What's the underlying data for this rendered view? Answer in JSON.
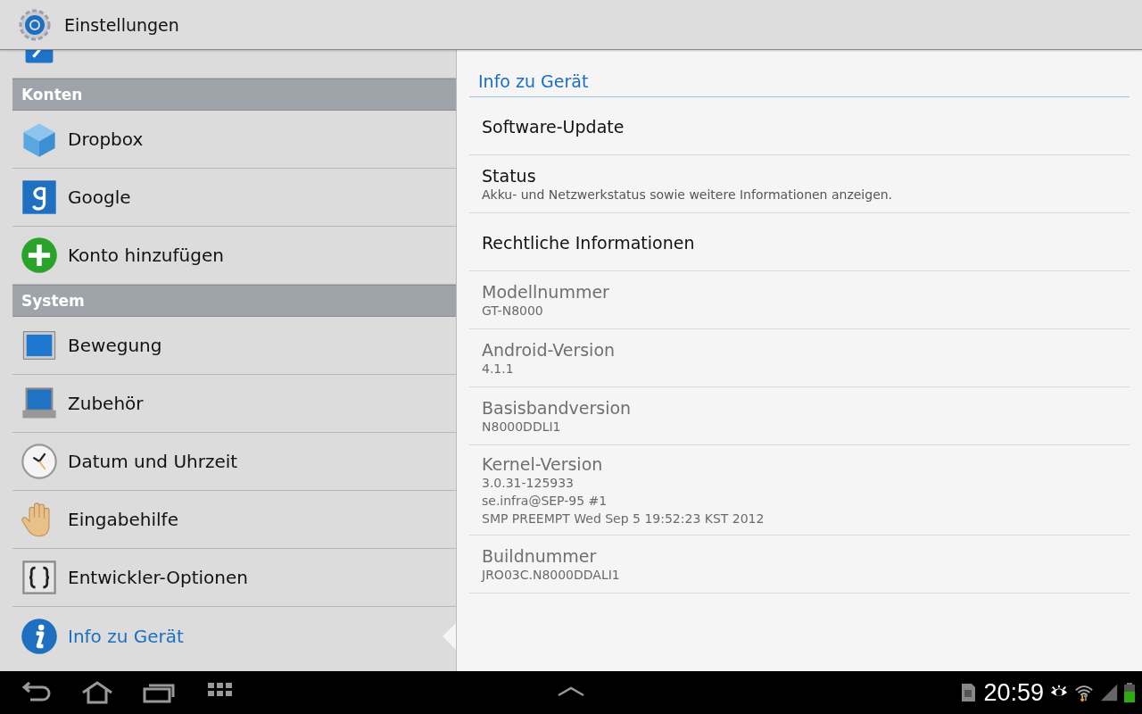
{
  "action_bar": {
    "title": "Einstellungen"
  },
  "sidebar": {
    "sections": [
      {
        "items": [
          {
            "selected": false
          }
        ]
      },
      {
        "header": "Konten",
        "items": [
          {
            "label": "Dropbox",
            "selected": false
          },
          {
            "label": "Google",
            "selected": false
          },
          {
            "label": "Konto hinzufügen",
            "selected": false
          }
        ]
      },
      {
        "header": "System",
        "items": [
          {
            "label": "Bewegung",
            "selected": false
          },
          {
            "label": "Zubehör",
            "selected": false
          },
          {
            "label": "Datum und Uhrzeit",
            "selected": false
          },
          {
            "label": "Eingabehilfe",
            "selected": false
          },
          {
            "label": "Entwickler-Optionen",
            "selected": false
          },
          {
            "label": "Info zu Gerät",
            "selected": true
          }
        ]
      }
    ]
  },
  "detail": {
    "title": "Info zu Gerät",
    "items": [
      {
        "title": "Software-Update",
        "disabled": false
      },
      {
        "title": "Status",
        "summary": [
          "Akku- und Netzwerkstatus sowie weitere Informationen anzeigen."
        ],
        "disabled": false
      },
      {
        "title": "Rechtliche Informationen",
        "disabled": false
      },
      {
        "title": "Modellnummer",
        "summary": [
          "GT-N8000"
        ],
        "disabled": true
      },
      {
        "title": "Android-Version",
        "summary": [
          "4.1.1"
        ],
        "disabled": true
      },
      {
        "title": "Basisbandversion",
        "summary": [
          "N8000DDLI1"
        ],
        "disabled": true
      },
      {
        "title": "Kernel-Version",
        "summary": [
          "3.0.31-125933",
          "se.infra@SEP-95 #1",
          "SMP PREEMPT Wed Sep 5 19:52:23 KST 2012"
        ],
        "disabled": true
      },
      {
        "title": "Buildnummer",
        "summary": [
          "JRO03C.N8000DDALI1"
        ],
        "disabled": true
      }
    ]
  },
  "system_bar": {
    "time": "20:59"
  }
}
